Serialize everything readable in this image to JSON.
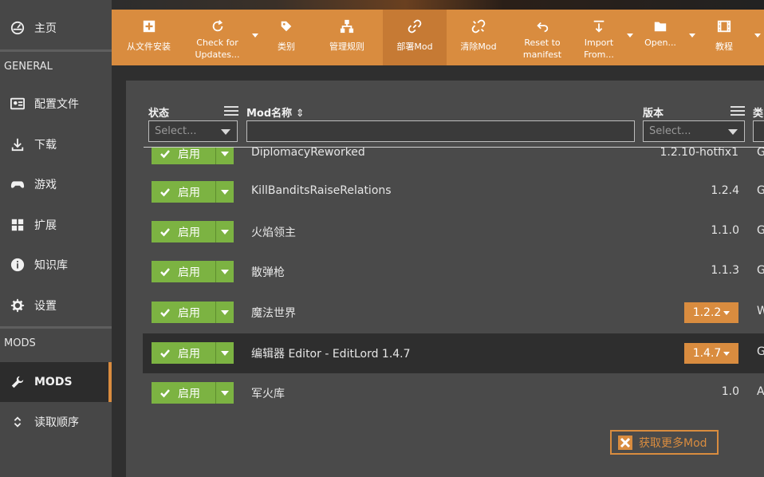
{
  "sidebar": {
    "home": "主页",
    "section_general": "GENERAL",
    "items": [
      {
        "label": "配置文件",
        "icon": "profile-card-icon"
      },
      {
        "label": "下载",
        "icon": "download-icon"
      },
      {
        "label": "游戏",
        "icon": "gamepad-icon"
      },
      {
        "label": "扩展",
        "icon": "extensions-icon"
      },
      {
        "label": "知识库",
        "icon": "info-icon"
      },
      {
        "label": "设置",
        "icon": "gear-icon"
      }
    ],
    "section_mods": "MODS",
    "mods": "MODS",
    "load_order": "读取顺序"
  },
  "toolbar": {
    "buttons": [
      {
        "label": "从文件安装",
        "icon": "plus-box-icon"
      },
      {
        "label": "Check for Updates...",
        "icon": "refresh-icon"
      },
      {
        "label": "类别",
        "icon": "tag-icon"
      },
      {
        "label": "管理规则",
        "icon": "hierarchy-icon"
      },
      {
        "label": "部署Mod",
        "icon": "link-icon"
      },
      {
        "label": "清除Mod",
        "icon": "unlink-icon"
      },
      {
        "label": "Reset to manifest",
        "icon": "undo-icon"
      },
      {
        "label": "Import From...",
        "icon": "import-icon"
      },
      {
        "label": "Open...",
        "icon": "folder-icon"
      },
      {
        "label": "教程",
        "icon": "film-icon"
      }
    ]
  },
  "table": {
    "col_status": "状态",
    "col_name": "Mod名称",
    "col_version": "版本",
    "col_category": "类",
    "select_placeholder": "Select...",
    "enabled_label": "启用",
    "rows": [
      {
        "name": "DiplomacyReworked",
        "version": "1.2.10-hotfix1",
        "category": "G"
      },
      {
        "name": "KillBanditsRaiseRelations",
        "version": "1.2.4",
        "category": "G"
      },
      {
        "name": "火焰领主",
        "version": "1.1.0",
        "category": "G"
      },
      {
        "name": "散弹枪",
        "version": "1.1.3",
        "category": "G"
      },
      {
        "name": "魔法世界",
        "version": "1.2.2",
        "category": "W"
      },
      {
        "name": "编辑器 Editor - EditLord 1.4.7",
        "version": "1.4.7",
        "category": "G"
      },
      {
        "name": "军火库",
        "version": "1.0",
        "category": "A"
      }
    ]
  },
  "more_mods": "获取更多Mod",
  "colors": {
    "accent": "#d98c3f",
    "enabled": "#7cb342",
    "sidebar": "#474747"
  }
}
